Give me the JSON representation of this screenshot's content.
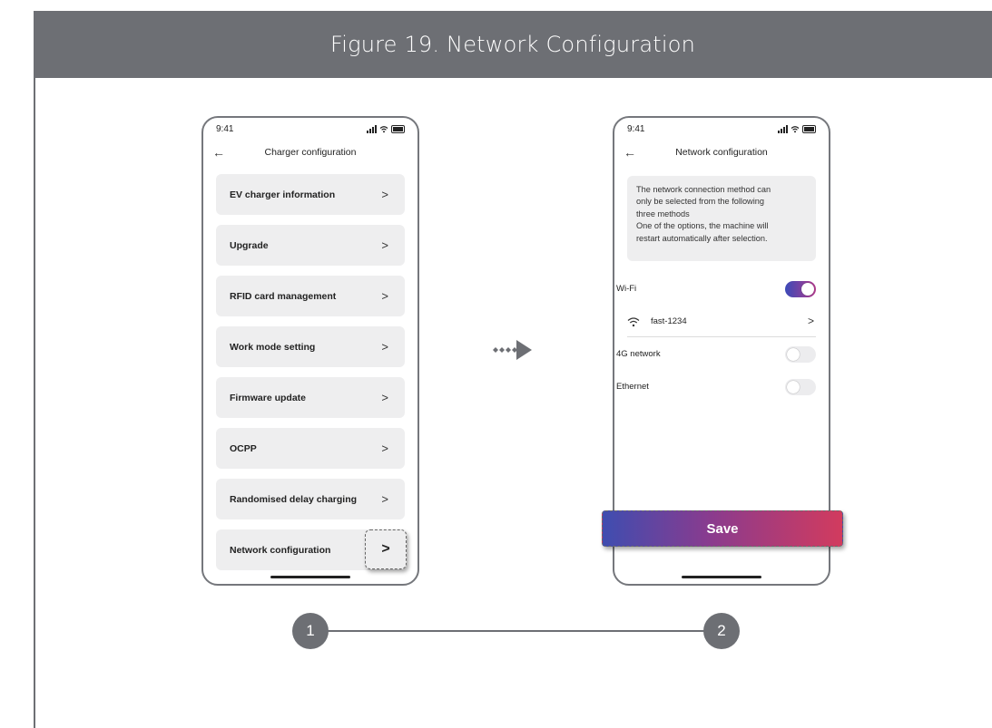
{
  "figure": {
    "title": "Figure 19.  Network Configuration"
  },
  "phone1": {
    "time": "9:41",
    "back_icon": "arrow-left-icon",
    "title": "Charger configuration",
    "items": [
      {
        "label": "EV charger information",
        "chevron": ">"
      },
      {
        "label": "Upgrade",
        "chevron": ">"
      },
      {
        "label": "RFID card management",
        "chevron": ">"
      },
      {
        "label": "Work mode setting",
        "chevron": ">"
      },
      {
        "label": "Firmware update",
        "chevron": ">"
      },
      {
        "label": "OCPP",
        "chevron": ">"
      },
      {
        "label": "Randomised delay charging",
        "chevron": ">"
      },
      {
        "label": "Network configuration",
        "chevron": ">"
      }
    ]
  },
  "phone2": {
    "time": "9:41",
    "title": "Network configuration",
    "info_lines": [
      "The network connection method can",
      "only be selected from the following",
      "three methods",
      "One of the options, the machine will",
      "restart automatically after selection."
    ],
    "wifi": {
      "label": "Wi-Fi",
      "enabled": true
    },
    "wifi_network": {
      "name": "fast-1234",
      "chevron": ">"
    },
    "network_4g": {
      "label": "4G network",
      "enabled": false
    },
    "ethernet": {
      "label": "Ethernet",
      "enabled": false
    },
    "save_label": "Save"
  },
  "steps": [
    "1",
    "2"
  ],
  "colors": {
    "frame": "#6d6f74",
    "card": "#eeeeef",
    "gradient_start": "#3f4db0",
    "gradient_end": "#d23b5e"
  }
}
